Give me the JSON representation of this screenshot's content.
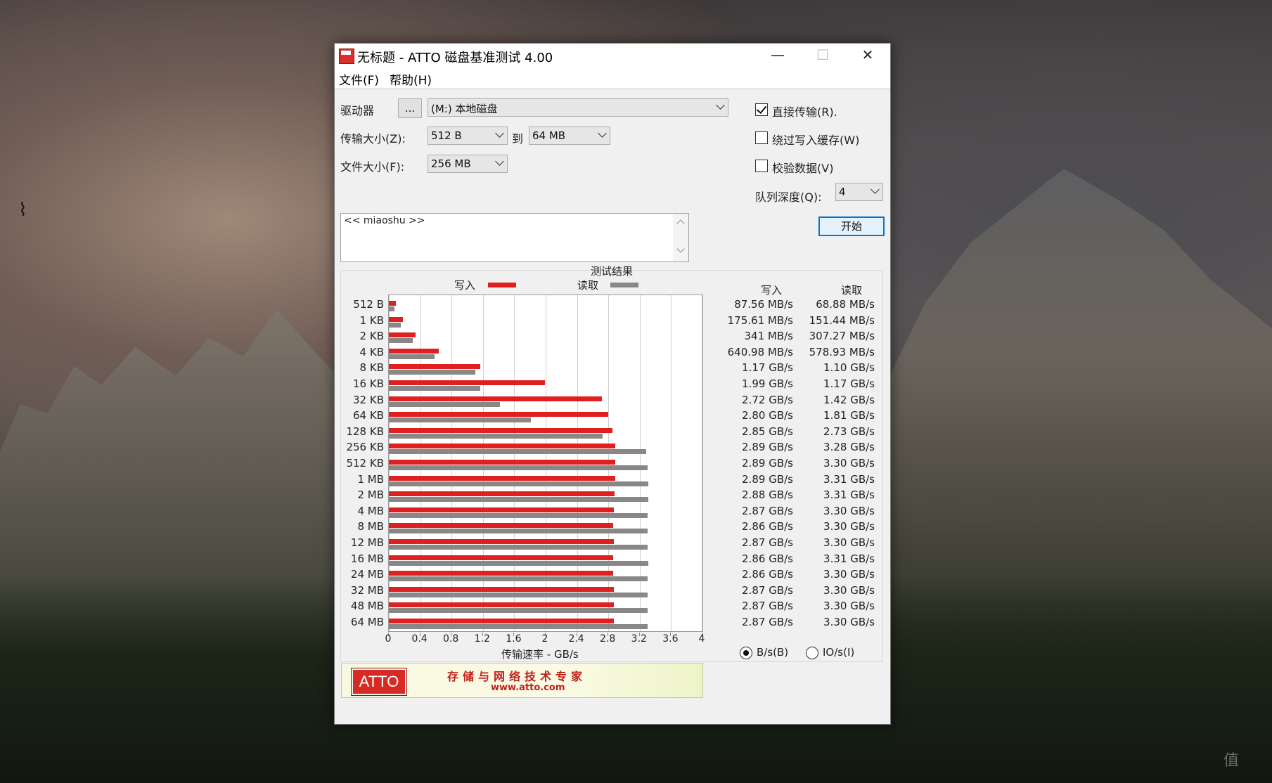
{
  "window": {
    "title": "无标题 - ATTO 磁盘基准测试 4.00",
    "minimize_glyph": "—",
    "maximize_glyph": "☐",
    "close_glyph": "✕"
  },
  "menu": {
    "file": "文件(F)",
    "help": "帮助(H)"
  },
  "form": {
    "drive_label": "驱动器",
    "browse_button": "...",
    "drive_value": "(M:) 本地磁盘",
    "transfer_size_label": "传输大小(Z):",
    "transfer_from": "512 B",
    "to_label": "到",
    "transfer_to": "64 MB",
    "file_size_label": "文件大小(F):",
    "file_size": "256 MB",
    "direct_io_label": "直接传输(R).",
    "direct_io_checked": true,
    "bypass_cache_label": "绕过写入缓存(W)",
    "bypass_cache_checked": false,
    "verify_label": "校验数据(V)",
    "verify_checked": false,
    "queue_depth_label": "队列深度(Q):",
    "queue_depth": "4",
    "start_button": "开始",
    "description": "<< miaoshu >>"
  },
  "results": {
    "heading": "测试结果",
    "legend_write": "写入",
    "legend_read": "读取",
    "col_write": "写入",
    "col_read": "读取",
    "x_axis_label": "传输速率 - GB/s",
    "unit_bytes": "B/s(B)",
    "unit_io": "IO/s(I)",
    "unit_bytes_selected": true,
    "colors": {
      "write": "#e02020",
      "read": "#888888"
    },
    "rows": [
      {
        "size": "512 B",
        "write": "87.56 MB/s",
        "read": "68.88 MB/s"
      },
      {
        "size": "1 KB",
        "write": "175.61 MB/s",
        "read": "151.44 MB/s"
      },
      {
        "size": "2 KB",
        "write": "341 MB/s",
        "read": "307.27 MB/s"
      },
      {
        "size": "4 KB",
        "write": "640.98 MB/s",
        "read": "578.93 MB/s"
      },
      {
        "size": "8 KB",
        "write": "1.17 GB/s",
        "read": "1.10 GB/s"
      },
      {
        "size": "16 KB",
        "write": "1.99 GB/s",
        "read": "1.17 GB/s"
      },
      {
        "size": "32 KB",
        "write": "2.72 GB/s",
        "read": "1.42 GB/s"
      },
      {
        "size": "64 KB",
        "write": "2.80 GB/s",
        "read": "1.81 GB/s"
      },
      {
        "size": "128 KB",
        "write": "2.85 GB/s",
        "read": "2.73 GB/s"
      },
      {
        "size": "256 KB",
        "write": "2.89 GB/s",
        "read": "3.28 GB/s"
      },
      {
        "size": "512 KB",
        "write": "2.89 GB/s",
        "read": "3.30 GB/s"
      },
      {
        "size": "1 MB",
        "write": "2.89 GB/s",
        "read": "3.31 GB/s"
      },
      {
        "size": "2 MB",
        "write": "2.88 GB/s",
        "read": "3.31 GB/s"
      },
      {
        "size": "4 MB",
        "write": "2.87 GB/s",
        "read": "3.30 GB/s"
      },
      {
        "size": "8 MB",
        "write": "2.86 GB/s",
        "read": "3.30 GB/s"
      },
      {
        "size": "12 MB",
        "write": "2.87 GB/s",
        "read": "3.30 GB/s"
      },
      {
        "size": "16 MB",
        "write": "2.86 GB/s",
        "read": "3.31 GB/s"
      },
      {
        "size": "24 MB",
        "write": "2.86 GB/s",
        "read": "3.30 GB/s"
      },
      {
        "size": "32 MB",
        "write": "2.87 GB/s",
        "read": "3.30 GB/s"
      },
      {
        "size": "48 MB",
        "write": "2.87 GB/s",
        "read": "3.30 GB/s"
      },
      {
        "size": "64 MB",
        "write": "2.87 GB/s",
        "read": "3.30 GB/s"
      }
    ]
  },
  "chart_data": {
    "type": "bar",
    "orientation": "horizontal",
    "title": "测试结果",
    "xlabel": "传输速率 - GB/s",
    "ylabel": "",
    "xlim": [
      0,
      4
    ],
    "x_ticks": [
      "0",
      "0.4",
      "0.8",
      "1.2",
      "1.6",
      "2",
      "2.4",
      "2.8",
      "3.2",
      "3.6",
      "4"
    ],
    "grid": true,
    "legend_position": "top",
    "categories": [
      "512 B",
      "1 KB",
      "2 KB",
      "4 KB",
      "8 KB",
      "16 KB",
      "32 KB",
      "64 KB",
      "128 KB",
      "256 KB",
      "512 KB",
      "1 MB",
      "2 MB",
      "4 MB",
      "8 MB",
      "12 MB",
      "16 MB",
      "24 MB",
      "32 MB",
      "48 MB",
      "64 MB"
    ],
    "series": [
      {
        "name": "写入",
        "color": "#e02020",
        "values": [
          0.08756,
          0.17561,
          0.341,
          0.64098,
          1.17,
          1.99,
          2.72,
          2.8,
          2.85,
          2.89,
          2.89,
          2.89,
          2.88,
          2.87,
          2.86,
          2.87,
          2.86,
          2.86,
          2.87,
          2.87,
          2.87
        ]
      },
      {
        "name": "读取",
        "color": "#888888",
        "values": [
          0.06888,
          0.15144,
          0.30727,
          0.57893,
          1.1,
          1.17,
          1.42,
          1.81,
          2.73,
          3.28,
          3.3,
          3.31,
          3.31,
          3.3,
          3.3,
          3.3,
          3.31,
          3.3,
          3.3,
          3.3,
          3.3
        ]
      }
    ]
  },
  "banner": {
    "logo_text": "ATTO",
    "slogan": "存储与网络技术专家",
    "url": "www.atto.com"
  }
}
